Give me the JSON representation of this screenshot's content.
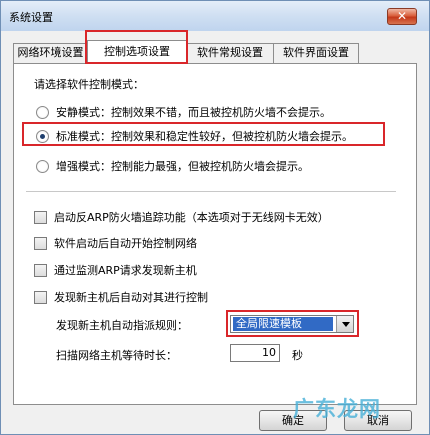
{
  "window": {
    "title": "系统设置",
    "close_label": "✕"
  },
  "tabs": [
    {
      "label": "网络环境设置"
    },
    {
      "label": "控制选项设置"
    },
    {
      "label": "软件常规设置"
    },
    {
      "label": "软件界面设置"
    }
  ],
  "mode": {
    "prompt": "请选择软件控制模式：",
    "options": [
      {
        "label": "安静模式：控制效果不错，而且被控机防火墙不会提示。",
        "checked": false
      },
      {
        "label": "标准模式：控制效果和稳定性较好，但被控机防火墙会提示。",
        "checked": true
      },
      {
        "label": "增强模式：控制能力最强，但被控机防火墙会提示。",
        "checked": false
      }
    ]
  },
  "options": [
    {
      "label": "启动反ARP防火墙追踪功能（本选项对于无线网卡无效）"
    },
    {
      "label": "软件启动后自动开始控制网络"
    },
    {
      "label": "通过监测ARP请求发现新主机"
    },
    {
      "label": "发现新主机后自动对其进行控制"
    }
  ],
  "auto_assign": {
    "label": "发现新主机自动指派规则：",
    "value": "全局限速模板"
  },
  "scan_wait": {
    "label": "扫描网络主机等待时长：",
    "value": "10",
    "unit": "秒"
  },
  "buttons": {
    "ok": "确定",
    "cancel": "取消"
  },
  "watermark": "广东龙网"
}
